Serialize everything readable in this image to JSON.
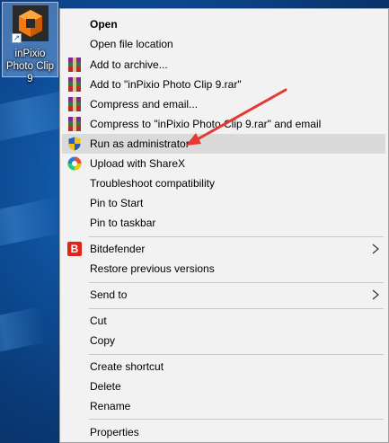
{
  "desktop": {
    "icon_label": "inPixio Photo Clip 9",
    "icon_name": "inpixio-app-icon"
  },
  "menu": {
    "items": [
      {
        "label": "Open",
        "icon": ""
      },
      {
        "label": "Open file location",
        "icon": ""
      },
      {
        "label": "Add to archive...",
        "icon": "winrar-icon"
      },
      {
        "label": "Add to \"inPixio Photo Clip 9.rar\"",
        "icon": "winrar-icon"
      },
      {
        "label": "Compress and email...",
        "icon": "winrar-icon"
      },
      {
        "label": "Compress to \"inPixio Photo Clip 9.rar\" and email",
        "icon": "winrar-icon"
      },
      {
        "label": "Run as administrator",
        "icon": "uac-shield-icon"
      },
      {
        "label": "Upload with ShareX",
        "icon": "sharex-icon"
      },
      {
        "label": "Troubleshoot compatibility",
        "icon": ""
      },
      {
        "label": "Pin to Start",
        "icon": ""
      },
      {
        "label": "Pin to taskbar",
        "icon": ""
      },
      {
        "label": "Bitdefender",
        "icon": "bitdefender-icon",
        "bitdefender_letter": "B"
      },
      {
        "label": "Restore previous versions",
        "icon": ""
      },
      {
        "label": "Send to",
        "icon": ""
      },
      {
        "label": "Cut",
        "icon": ""
      },
      {
        "label": "Copy",
        "icon": ""
      },
      {
        "label": "Create shortcut",
        "icon": ""
      },
      {
        "label": "Delete",
        "icon": ""
      },
      {
        "label": "Rename",
        "icon": ""
      },
      {
        "label": "Properties",
        "icon": ""
      }
    ]
  },
  "colors": {
    "menu_bg": "#f2f2f2",
    "hover_bg": "#dadada",
    "annotation_arrow": "#e53935"
  }
}
